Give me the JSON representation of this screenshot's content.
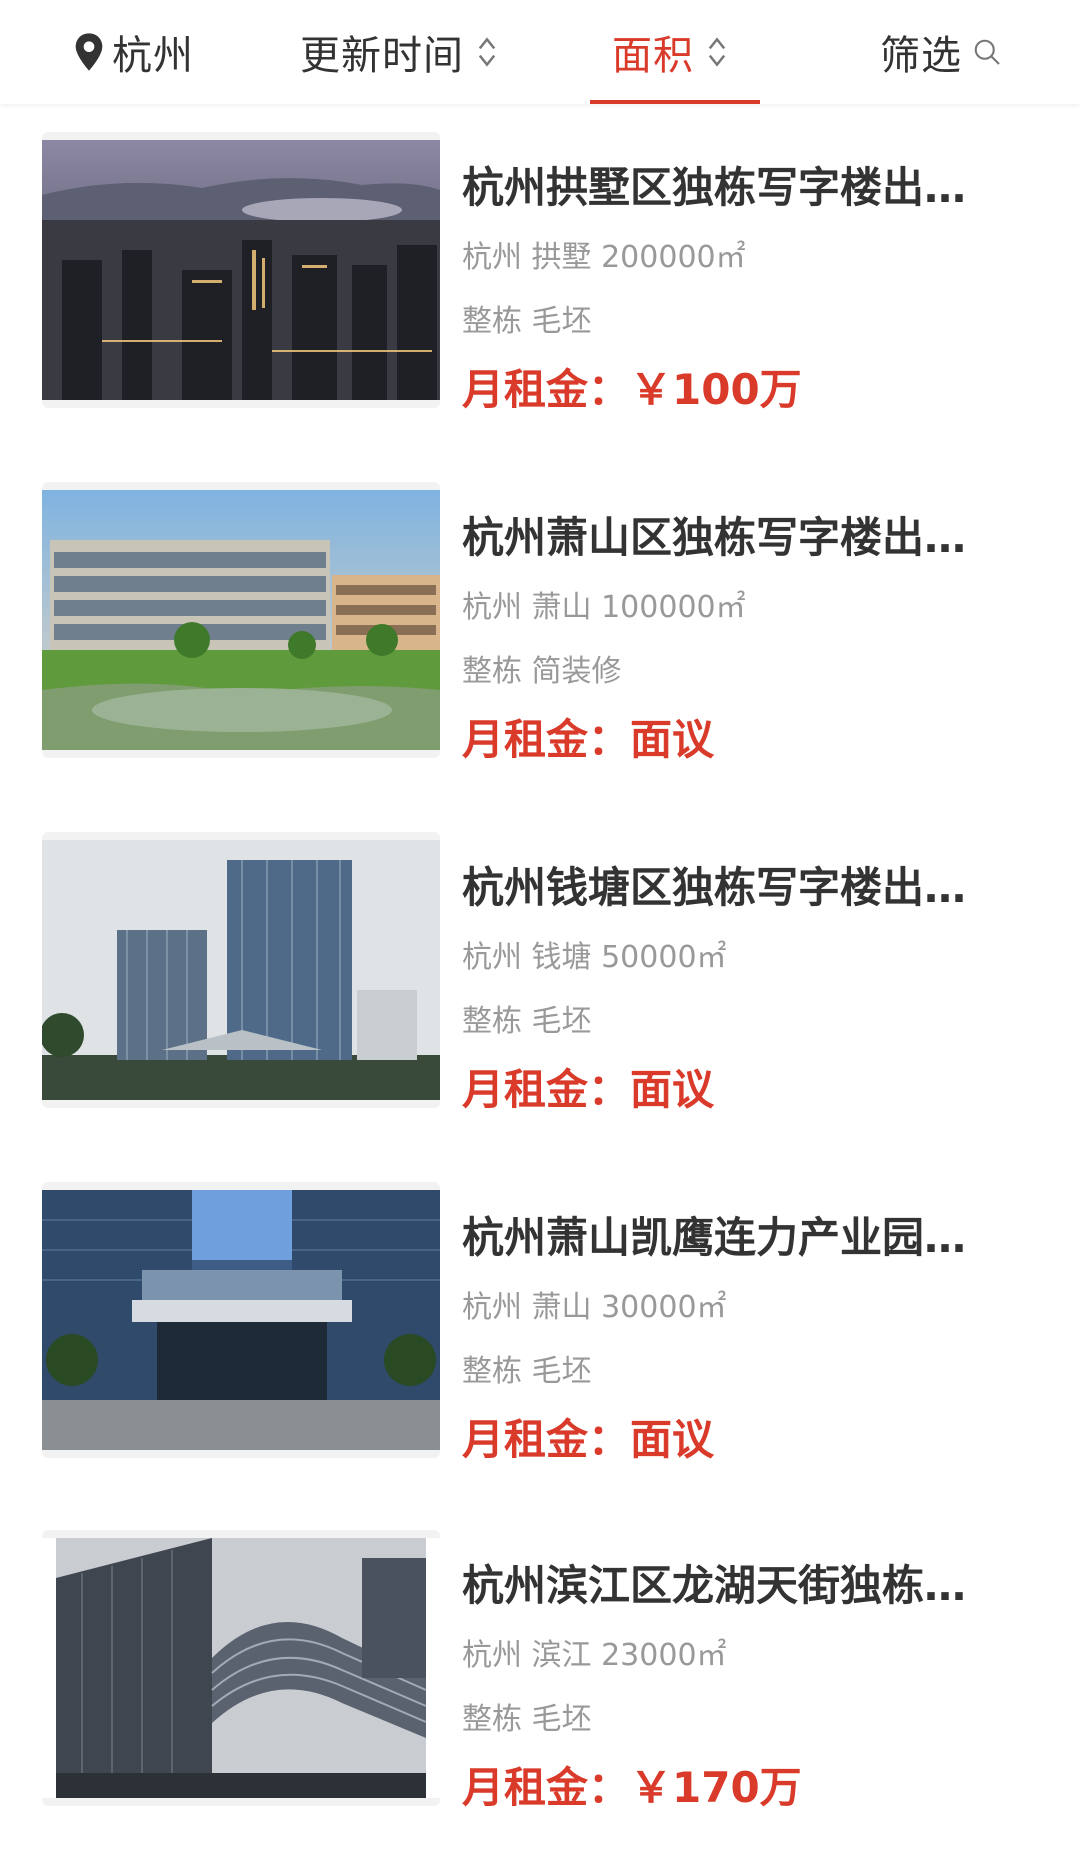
{
  "filters": {
    "city": "杭州",
    "update_time": "更新时间",
    "area": "面积",
    "filter": "筛选"
  },
  "colors": {
    "accent": "#d93a2a",
    "text": "#333333",
    "muted": "#999999"
  },
  "listings": [
    {
      "title": "杭州拱墅区独栋写字楼出…",
      "district": "杭州 拱墅",
      "area": "200000㎡",
      "type": "整栋",
      "decoration": "毛坯",
      "rent_label": "月租金：",
      "rent_value": "￥100万"
    },
    {
      "title": "杭州萧山区独栋写字楼出…",
      "district": "杭州 萧山",
      "area": "100000㎡",
      "type": "整栋",
      "decoration": "简装修",
      "rent_label": "月租金：",
      "rent_value": "面议"
    },
    {
      "title": "杭州钱塘区独栋写字楼出…",
      "district": "杭州 钱塘",
      "area": "50000㎡",
      "type": "整栋",
      "decoration": "毛坯",
      "rent_label": "月租金：",
      "rent_value": "面议"
    },
    {
      "title": "杭州萧山凯鹰连力产业园…",
      "district": "杭州 萧山",
      "area": "30000㎡",
      "type": "整栋",
      "decoration": "毛坯",
      "rent_label": "月租金：",
      "rent_value": "面议"
    },
    {
      "title": "杭州滨江区龙湖天街独栋…",
      "district": "杭州 滨江",
      "area": "23000㎡",
      "type": "整栋",
      "decoration": "毛坯",
      "rent_label": "月租金：",
      "rent_value": "￥170万"
    }
  ]
}
